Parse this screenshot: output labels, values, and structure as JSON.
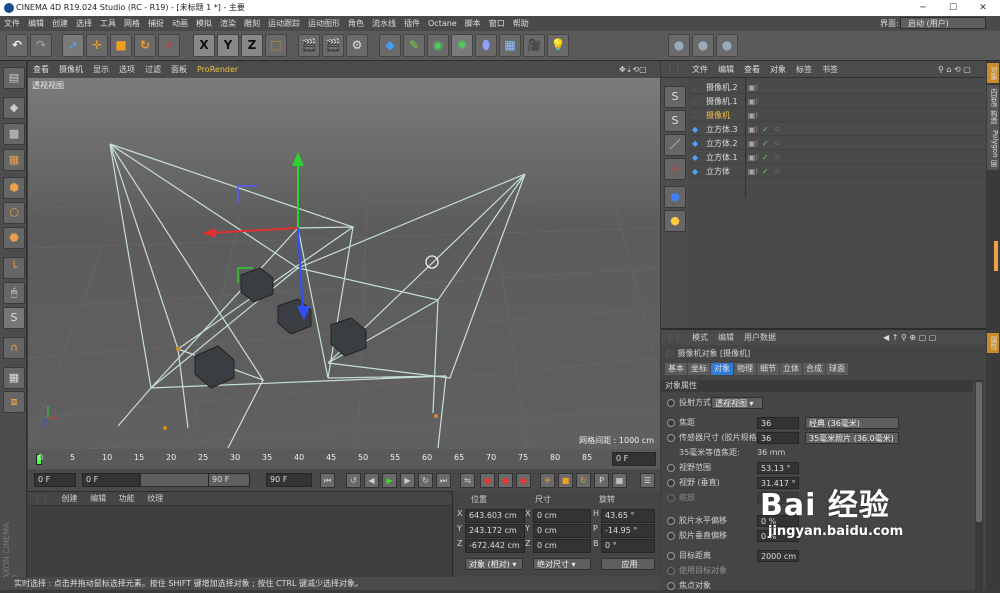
{
  "title": "CINEMA 4D R19.024 Studio (RC - R19) - [未标题 1 *] - 主要",
  "menu": [
    "文件",
    "编辑",
    "创建",
    "选择",
    "工具",
    "网格",
    "捕捉",
    "动画",
    "模拟",
    "渲染",
    "雕刻",
    "运动跟踪",
    "运动图形",
    "角色",
    "流水线",
    "插件",
    "Octane",
    "脚本",
    "窗口",
    "帮助"
  ],
  "layout_label": "界面:",
  "layout_value": "启动 (用户)",
  "viewport_menu": [
    "查看",
    "摄像机",
    "显示",
    "选项",
    "过滤",
    "面板",
    "ProRender"
  ],
  "viewport_name": "透视视图",
  "grid_spacing": "网格间距 : 1000 cm",
  "timeline_ticks": [
    "0",
    "5",
    "10",
    "15",
    "20",
    "25",
    "30",
    "35",
    "40",
    "45",
    "50",
    "55",
    "60",
    "65",
    "70",
    "75",
    "80",
    "85",
    "90"
  ],
  "timeline_end_field": "0 F",
  "transport": {
    "start": "0 F",
    "current": "0 F",
    "end": "90 F",
    "end2": "90 F"
  },
  "mat_menu": [
    "创建",
    "编辑",
    "功能",
    "纹理"
  ],
  "coords": {
    "headers": [
      "位置",
      "尺寸",
      "旋转"
    ],
    "rows": [
      {
        "a": "X",
        "pos": "643.603 cm",
        "b": "X",
        "size": "0 cm",
        "c": "H",
        "rot": "43.65 °"
      },
      {
        "a": "Y",
        "pos": "243.172 cm",
        "b": "Y",
        "size": "0 cm",
        "c": "P",
        "rot": "-14.95 °"
      },
      {
        "a": "Z",
        "pos": "-672.442 cm",
        "b": "Z",
        "size": "0 cm",
        "c": "B",
        "rot": "0 °"
      }
    ],
    "mode1": "对象 (相对)",
    "mode2": "绝对尺寸",
    "apply": "应用"
  },
  "status": "实时选择 : 点击并拖动鼠标选择元素。按住 SHIFT 键增加选择对象 ; 按住 CTRL 键减少选择对象。",
  "obj_menu": [
    "文件",
    "编辑",
    "查看",
    "对象",
    "标签",
    "书签"
  ],
  "objects": [
    {
      "name": "摄像机.2",
      "type": "camera",
      "selected": false
    },
    {
      "name": "摄像机.1",
      "type": "camera",
      "selected": false
    },
    {
      "name": "摄像机",
      "type": "camera",
      "selected": true
    },
    {
      "name": "立方体.3",
      "type": "cube",
      "selected": false
    },
    {
      "name": "立方体.2",
      "type": "cube",
      "selected": false
    },
    {
      "name": "立方体.1",
      "type": "cube",
      "selected": false
    },
    {
      "name": "立方体",
      "type": "cube",
      "selected": false
    }
  ],
  "attr_menu": [
    "模式",
    "编辑",
    "用户数据"
  ],
  "attr_object": "摄像机对象 [摄像机]",
  "attr_tabs": [
    "基本",
    "坐标",
    "对象",
    "物理",
    "细节",
    "立体",
    "合成",
    "球面"
  ],
  "attr_section": "对象属性",
  "attrs": {
    "projection_label": "投射方式",
    "projection_value": "透视视图",
    "focal_label": "焦距",
    "focal_value": "36",
    "focal_preset": "经典 (36毫米)",
    "sensor_label": "传感器尺寸 (胶片规格)",
    "sensor_value": "36",
    "sensor_preset": "35毫米照片 (36.0毫米)",
    "equiv_label": "35毫米等值焦距:",
    "equiv_value": "36 mm",
    "fov_label": "视野范围",
    "fov_value": "53.13 °",
    "fovv_label": "视野 (垂直)",
    "fovv_value": "31.417 °",
    "zoom_label": "缩放",
    "zoom_value": "1",
    "hshift_label": "胶片水平偏移",
    "hshift_value": "0 %",
    "vshift_label": "胶片垂直偏移",
    "vshift_value": "0 %",
    "target_label": "目标距离",
    "target_value": "2000 cm",
    "use_target_label": "使用目标对象",
    "focus_obj_label": "焦点对象"
  },
  "right_tabs": [
    "对象",
    "内容浏览器",
    "构造",
    "Polygon",
    "层",
    "属性"
  ],
  "watermark": "Bai 经验",
  "watermark_url": "jingyan.baidu.com",
  "colors": {
    "accent": "#e9a04a",
    "selected_text": "#f0c040",
    "wire": "#c6e0d4"
  }
}
